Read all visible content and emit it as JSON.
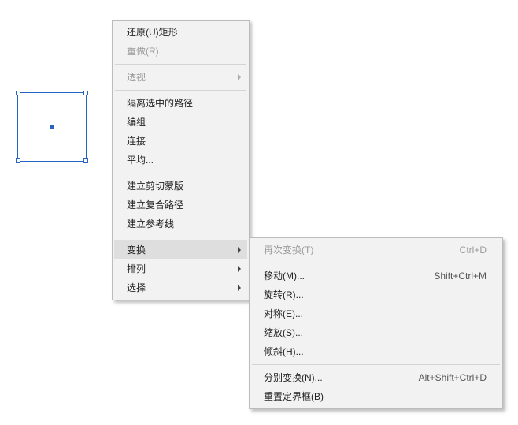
{
  "menu": {
    "items": [
      {
        "label": "还原(U)矩形",
        "type": "item"
      },
      {
        "label": "重做(R)",
        "type": "item",
        "disabled": true
      },
      {
        "type": "sep"
      },
      {
        "label": "透视",
        "type": "submenu",
        "disabled": true
      },
      {
        "type": "sep"
      },
      {
        "label": "隔离选中的路径",
        "type": "item"
      },
      {
        "label": "编组",
        "type": "item"
      },
      {
        "label": "连接",
        "type": "item"
      },
      {
        "label": "平均...",
        "type": "item"
      },
      {
        "type": "sep"
      },
      {
        "label": "建立剪切蒙版",
        "type": "item"
      },
      {
        "label": "建立复合路径",
        "type": "item"
      },
      {
        "label": "建立参考线",
        "type": "item"
      },
      {
        "type": "sep"
      },
      {
        "label": "变换",
        "type": "submenu",
        "highlight": true
      },
      {
        "label": "排列",
        "type": "submenu"
      },
      {
        "label": "选择",
        "type": "submenu"
      }
    ]
  },
  "submenu": {
    "items": [
      {
        "label": "再次变换(T)",
        "shortcut": "Ctrl+D",
        "disabled": true
      },
      {
        "type": "sep"
      },
      {
        "label": "移动(M)...",
        "shortcut": "Shift+Ctrl+M"
      },
      {
        "label": "旋转(R)..."
      },
      {
        "label": "对称(E)..."
      },
      {
        "label": "缩放(S)..."
      },
      {
        "label": "倾斜(H)..."
      },
      {
        "type": "sep"
      },
      {
        "label": "分别变换(N)...",
        "shortcut": "Alt+Shift+Ctrl+D"
      },
      {
        "label": "重置定界框(B)"
      }
    ]
  },
  "shape": {
    "type": "rectangle",
    "selected": true
  }
}
